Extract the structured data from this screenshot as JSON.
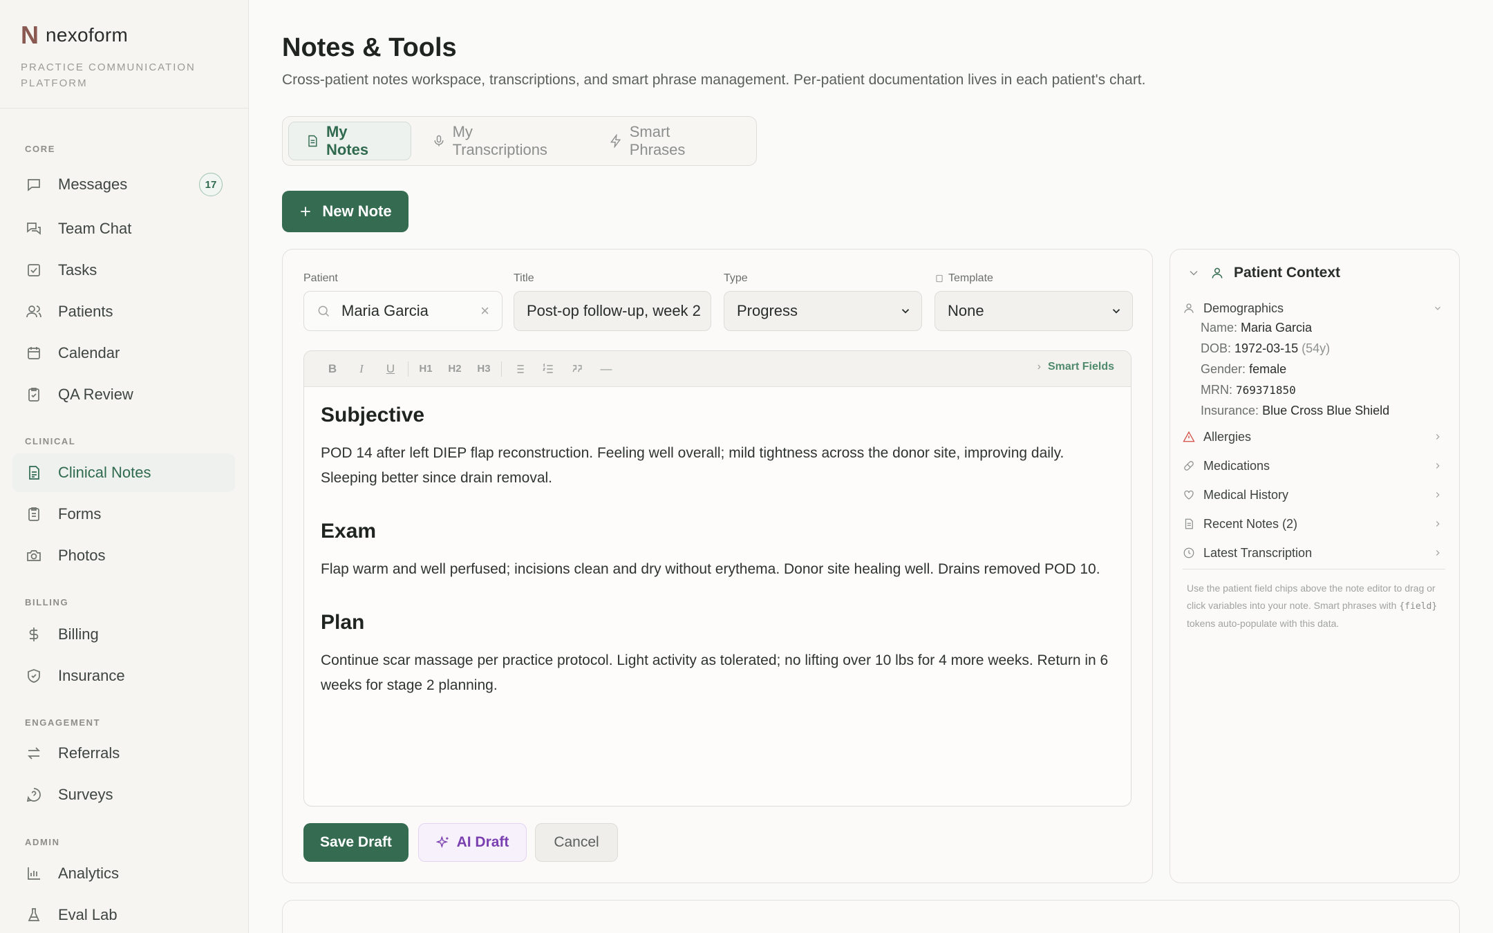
{
  "brand": {
    "mark": "N",
    "name": "nexoform",
    "tagline": "PRACTICE COMMUNICATION PLATFORM"
  },
  "sidebar": {
    "sections": {
      "core": "CORE",
      "clinical": "CLINICAL",
      "billing": "BILLING",
      "engagement": "ENGAGEMENT",
      "admin": "ADMIN"
    },
    "items": {
      "messages": {
        "label": "Messages",
        "icon": "message-icon",
        "badge": "17"
      },
      "team_chat": {
        "label": "Team Chat",
        "icon": "chat-icon"
      },
      "tasks": {
        "label": "Tasks",
        "icon": "check-square-icon"
      },
      "patients": {
        "label": "Patients",
        "icon": "users-icon"
      },
      "calendar": {
        "label": "Calendar",
        "icon": "calendar-icon"
      },
      "qa_review": {
        "label": "QA Review",
        "icon": "clipboard-check-icon"
      },
      "clinical_notes": {
        "label": "Clinical Notes",
        "icon": "file-text-icon",
        "active": true
      },
      "forms": {
        "label": "Forms",
        "icon": "clipboard-icon"
      },
      "photos": {
        "label": "Photos",
        "icon": "camera-icon"
      },
      "billing": {
        "label": "Billing",
        "icon": "dollar-icon"
      },
      "insurance": {
        "label": "Insurance",
        "icon": "shield-icon"
      },
      "referrals": {
        "label": "Referrals",
        "icon": "arrows-icon"
      },
      "surveys": {
        "label": "Surveys",
        "icon": "help-circle-icon"
      },
      "analytics": {
        "label": "Analytics",
        "icon": "bar-chart-icon"
      },
      "eval_lab": {
        "label": "Eval Lab",
        "icon": "flask-icon"
      }
    }
  },
  "page": {
    "title": "Notes & Tools",
    "description": "Cross-patient notes workspace, transcriptions, and smart phrase management. Per-patient documentation lives in each patient's chart."
  },
  "tabs": {
    "my_notes": "My Notes",
    "my_transcriptions": "My Transcriptions",
    "smart_phrases": "Smart Phrases"
  },
  "new_note_label": "New Note",
  "editor": {
    "labels": {
      "patient": "Patient",
      "title": "Title",
      "type": "Type",
      "template": "Template"
    },
    "values": {
      "patient": "Maria Garcia",
      "title": "Post-op follow-up, week 2",
      "type": "Progress",
      "template": "None"
    },
    "clear_glyph": "×",
    "toolbar": {
      "bold": "B",
      "italic": "I",
      "underline": "U",
      "h1": "H1",
      "h2": "H2",
      "h3": "H3",
      "hr": "—",
      "smart_fields": "Smart Fields"
    },
    "sections": [
      {
        "heading": "Subjective",
        "body": "POD 14 after left DIEP flap reconstruction. Feeling well overall; mild tightness across the donor site, improving daily. Sleeping better since drain removal."
      },
      {
        "heading": "Exam",
        "body": "Flap warm and well perfused; incisions clean and dry without erythema. Donor site healing well. Drains removed POD 10."
      },
      {
        "heading": "Plan",
        "body": "Continue scar massage per practice protocol. Light activity as tolerated; no lifting over 10 lbs for 4 more weeks. Return in 6 weeks for stage 2 planning."
      }
    ],
    "actions": {
      "save": "Save Draft",
      "ai": "AI Draft",
      "cancel": "Cancel"
    }
  },
  "context": {
    "title": "Patient Context",
    "demographics": {
      "label": "Demographics",
      "name_label": "Name:",
      "name": "Maria Garcia",
      "dob_label": "DOB:",
      "dob": "1972-03-15",
      "age": "(54y)",
      "gender_label": "Gender:",
      "gender": "female",
      "mrn_label": "MRN:",
      "mrn": "769371850",
      "insurance_label": "Insurance:",
      "insurance": "Blue Cross Blue Shield"
    },
    "rows": {
      "allergies": "Allergies",
      "medications": "Medications",
      "medical_history": "Medical History",
      "recent_notes": "Recent Notes (2)",
      "latest_transcription": "Latest Transcription"
    },
    "note_pre": "Use the patient field chips above the note editor to drag or click variables into your note. Smart phrases with ",
    "note_token": "{field}",
    "note_post": " tokens auto-populate with this data."
  },
  "colors": {
    "accent": "#356b50",
    "ai": "#7a3fb0",
    "warning": "#d2493f"
  }
}
